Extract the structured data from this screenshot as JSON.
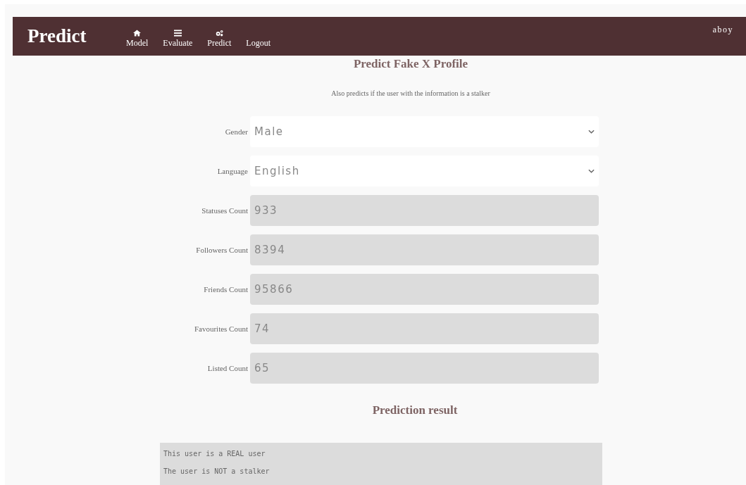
{
  "navbar": {
    "brand": "Predict",
    "links": [
      {
        "label": "Model"
      },
      {
        "label": "Evaluate"
      },
      {
        "label": "Predict"
      },
      {
        "label": "Logout"
      }
    ],
    "user": "aboy"
  },
  "form": {
    "title": "Predict Fake X Profile",
    "subtitle": "Also predicts if the user with the information is a stalker",
    "fields": [
      {
        "label": "Gender",
        "kind": "select",
        "value": "Male"
      },
      {
        "label": "Language",
        "kind": "select",
        "value": "English"
      },
      {
        "label": "Statuses Count",
        "kind": "input",
        "value": "933"
      },
      {
        "label": "Followers Count",
        "kind": "input",
        "value": "8394"
      },
      {
        "label": "Friends Count",
        "kind": "input",
        "value": "95866"
      },
      {
        "label": "Favourites Count",
        "kind": "input",
        "value": "74"
      },
      {
        "label": "Listed Count",
        "kind": "input",
        "value": "65"
      }
    ]
  },
  "result": {
    "title": "Prediction result",
    "lines": [
      "This user is a REAL user",
      "The user is NOT a stalker"
    ]
  }
}
